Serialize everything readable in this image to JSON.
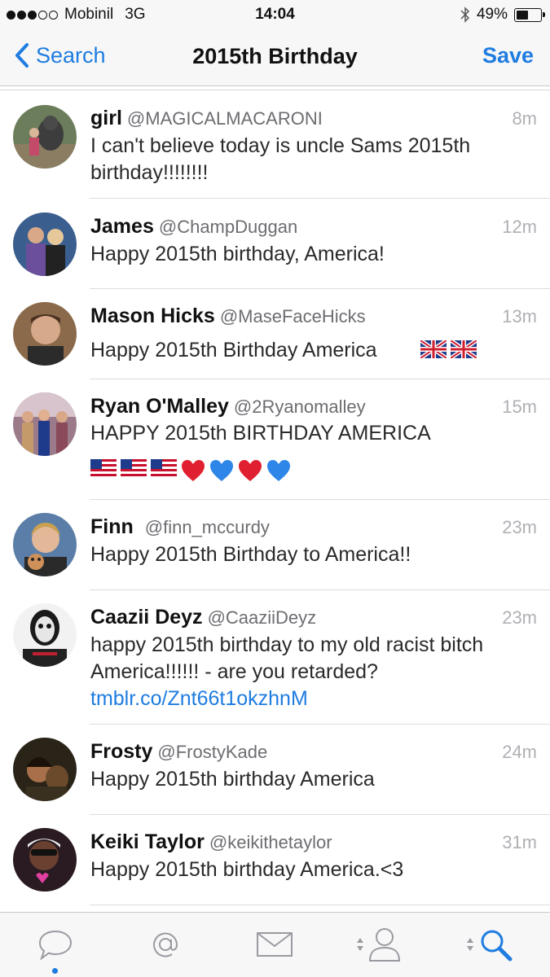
{
  "status_bar": {
    "carrier": "Mobinil",
    "network": "3G",
    "time": "14:04",
    "battery": "49%",
    "battery_level": 0.49
  },
  "nav": {
    "back_label": "Search",
    "title": "2015th Birthday",
    "save_label": "Save"
  },
  "tweets": [
    {
      "name": "girl",
      "handle": "@MAGICALMACARONI",
      "time": "8m",
      "text": "I can't believe today is uncle Sams 2015th birthday!!!!!!!!"
    },
    {
      "name": "James",
      "handle": "@ChampDuggan",
      "time": "12m",
      "text": "Happy 2015th birthday, America!"
    },
    {
      "name": "Mason Hicks",
      "handle": "@MaseFaceHicks",
      "time": "13m",
      "text": "Happy 2015th Birthday America",
      "emojis": [
        "uk-flag-icon",
        "uk-flag-icon"
      ]
    },
    {
      "name": "Ryan O'Malley",
      "handle": "@2Ryanomalley",
      "time": "15m",
      "text": "HAPPY 2015th BIRTHDAY AMERICA",
      "emojis": [
        "us-flag-icon",
        "us-flag-icon",
        "us-flag-icon",
        "red-heart-icon",
        "blue-heart-icon",
        "red-heart-icon",
        "blue-heart-icon"
      ]
    },
    {
      "name": "Finn",
      "handle": "@finn_mccurdy",
      "time": "23m",
      "text": "Happy 2015th Birthday to America!!"
    },
    {
      "name": "Caazii Deyz",
      "handle": "@CaaziiDeyz",
      "time": "23m",
      "text": "happy 2015th birthday to my old racist bitch America!!!!!! - are you retarded?",
      "link": "tmblr.co/Znt66t1okzhnM"
    },
    {
      "name": "Frosty",
      "handle": "@FrostyKade",
      "time": "24m",
      "text": "Happy 2015th birthday America"
    },
    {
      "name": "Keiki Taylor",
      "handle": "@keikithetaylor",
      "time": "31m",
      "text": "Happy 2015th birthday America.<3"
    }
  ],
  "tab_bar": {
    "tabs": [
      {
        "icon": "speech-bubble-icon",
        "active": true
      },
      {
        "icon": "at-sign-icon",
        "active": false
      },
      {
        "icon": "envelope-icon",
        "active": false
      },
      {
        "icon": "person-icon",
        "active": false
      },
      {
        "icon": "magnifier-icon",
        "active": false
      }
    ]
  },
  "colors": {
    "accent": "#1f7ce0",
    "time_gray": "#b0b0b5",
    "handle_gray": "#6d6d72",
    "bar_bg": "#f7f7f8"
  }
}
